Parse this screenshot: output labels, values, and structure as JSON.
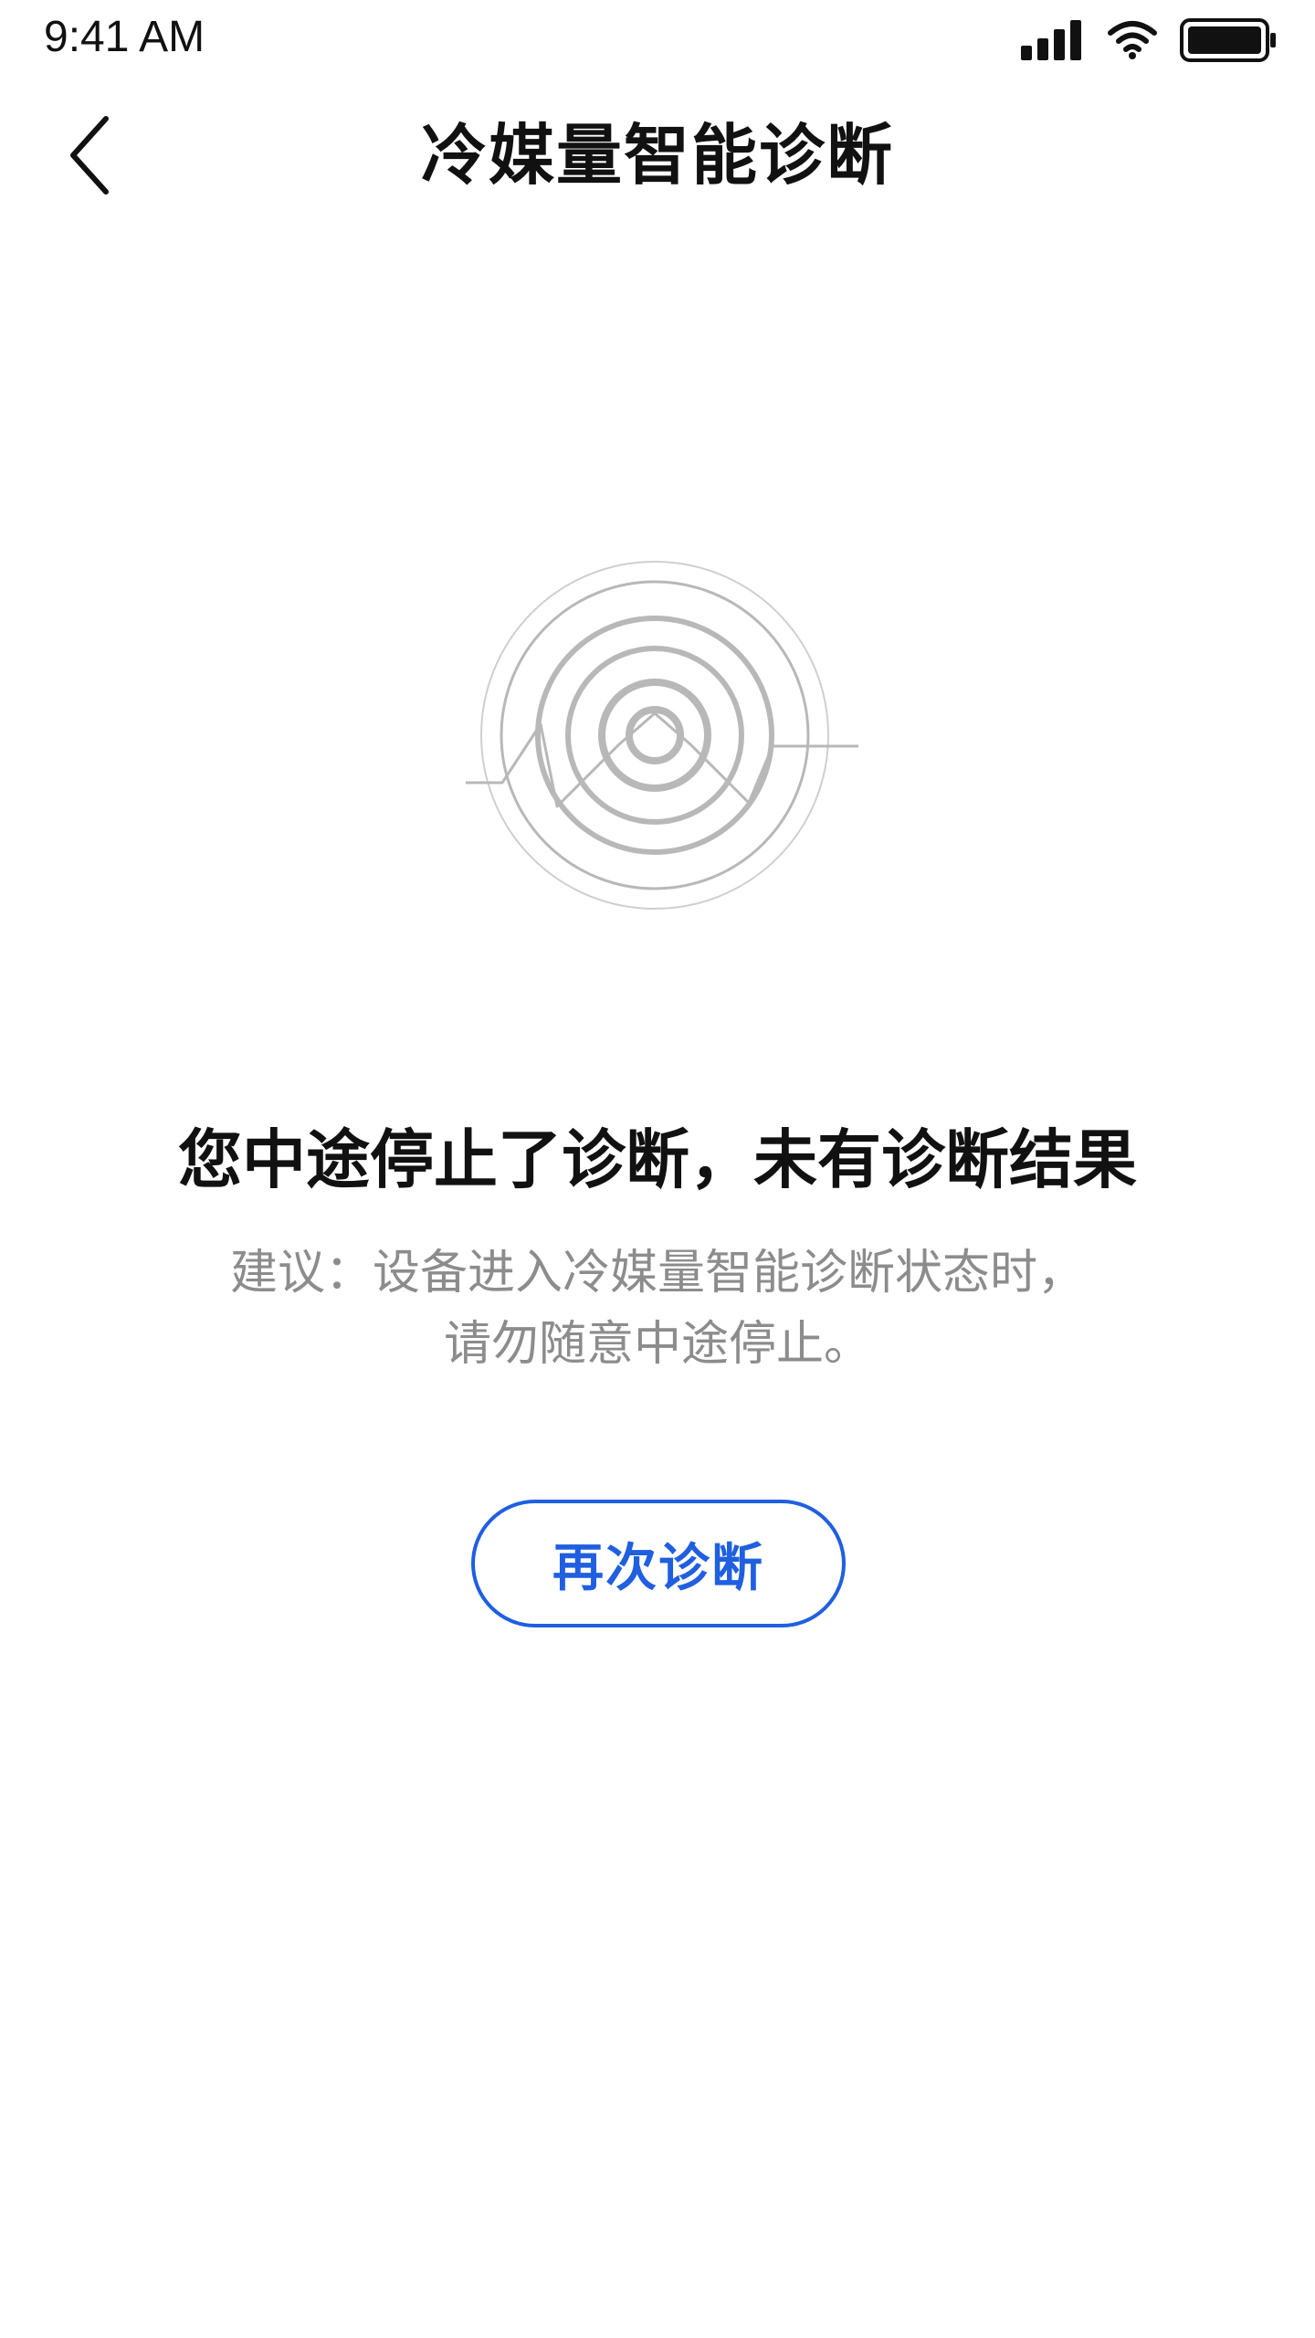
{
  "status_bar": {
    "time": "9:41 AM"
  },
  "nav": {
    "title": "冷媒量智能诊断",
    "back_icon": "chevron-left-icon"
  },
  "illustration": {
    "icon": "diagnosis-radar-icon",
    "stroke_color": "#b5b5b5"
  },
  "message": {
    "headline": "您中途停止了诊断，未有诊断结果",
    "suggestion_line1": "建议：设备进入冷媒量智能诊断状态时，",
    "suggestion_line2": "请勿随意中途停止。"
  },
  "actions": {
    "retry_label": "再次诊断"
  },
  "colors": {
    "accent": "#1f5fe0",
    "secondary_text": "#8c8c8c",
    "primary_text": "#111111"
  }
}
